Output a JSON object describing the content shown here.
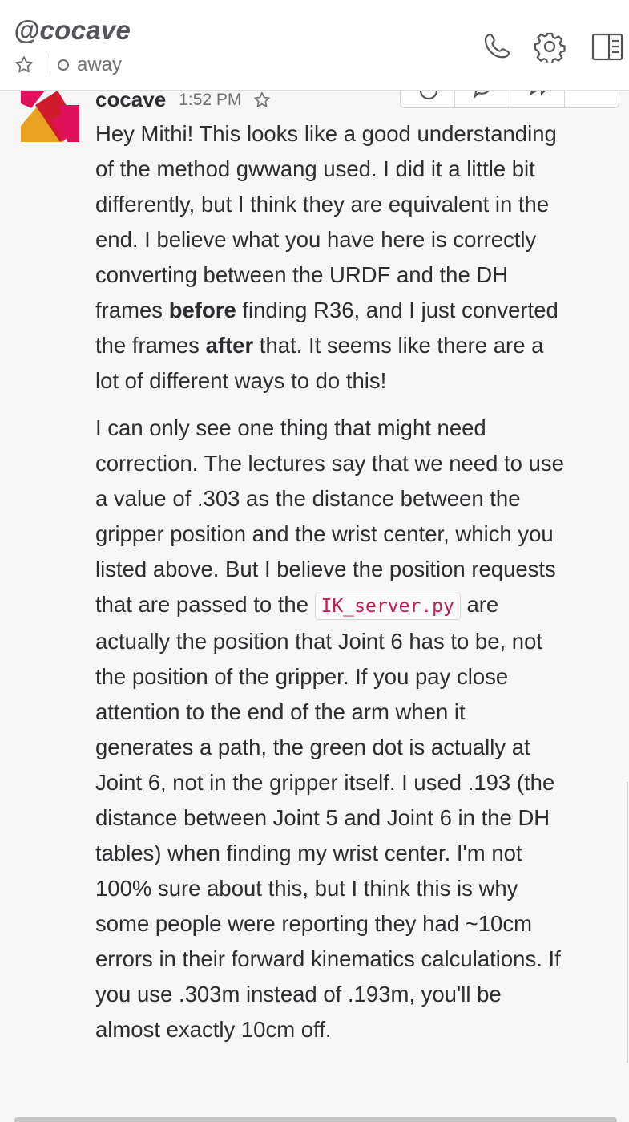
{
  "header": {
    "channel_name": "@cocave",
    "status": "away",
    "star_icon": "star-outline-icon",
    "icons": [
      "phone-icon",
      "gear-icon",
      "sidebar-toggle-icon"
    ]
  },
  "message": {
    "sender": "cocave",
    "time": "1:52 PM",
    "avatar_colors": [
      "#e8a321",
      "#cf1b2b",
      "#e0105c"
    ],
    "para1": {
      "t1": "Hey Mithi! This looks like a good understanding of the method gwwang used. I did it a little bit differently, but I think they are equivalent in the end. I believe what you have here is correctly converting between the URDF and the DH frames ",
      "b1": "before",
      "t2": " finding R36, and I just converted the frames ",
      "b2": "after",
      "t3": " that. It seems like there are a lot of different ways to do this!"
    },
    "para2": {
      "t1": "I can only see one thing that might need correction. The lectures say that we need to use a value of .303 as the distance between the gripper position and the wrist center, which you listed above.  But I believe the position requests that are passed to the ",
      "code": "IK_server.py",
      "t2": " are actually the position that Joint 6 has to be, not the position of the gripper. If you pay close attention to the end of the arm when it generates a path, the green dot is actually at Joint 6, not in the gripper itself. I used .193 (the distance between Joint 5 and Joint 6 in the DH tables) when finding my wrist center. I'm not 100% sure about this, but I think this is why some people were reporting they had ~10cm errors in their forward kinematics calculations. If you use .303m instead of .193m, you'll be almost exactly 10cm off."
    }
  },
  "colors": {
    "text": "#2c2d30",
    "muted": "#717274",
    "code": "#c41a4d",
    "background": "#f7f7f7"
  }
}
